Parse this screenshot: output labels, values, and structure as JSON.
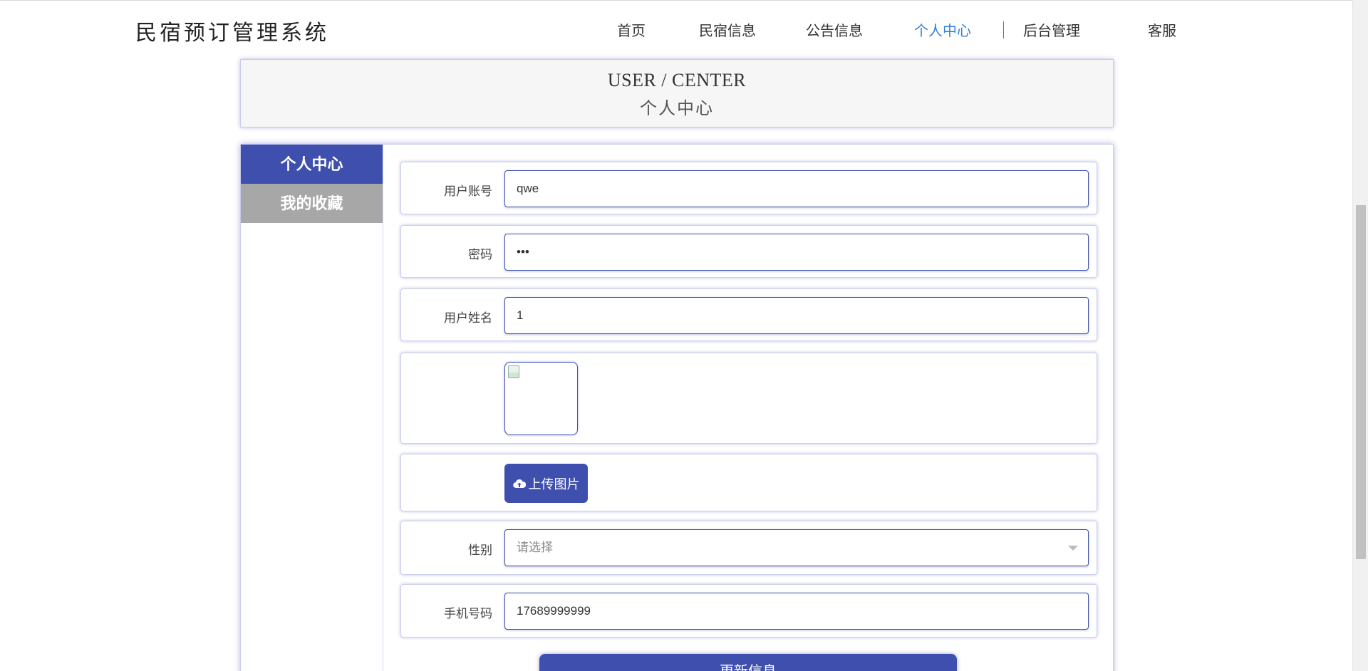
{
  "app": {
    "title": "民宿预订管理系统"
  },
  "nav": {
    "items": [
      {
        "label": "首页"
      },
      {
        "label": "民宿信息"
      },
      {
        "label": "公告信息"
      },
      {
        "label": "个人中心",
        "active": true
      },
      {
        "label": "后台管理"
      },
      {
        "label": "客服"
      }
    ]
  },
  "banner": {
    "title_en": "USER / CENTER",
    "title_cn": "个人中心"
  },
  "sidebar": {
    "items": [
      {
        "label": "个人中心",
        "active": true
      },
      {
        "label": "我的收藏",
        "active": false
      }
    ]
  },
  "form": {
    "account": {
      "label": "用户账号",
      "value": "qwe"
    },
    "password": {
      "label": "密码",
      "value": "•••"
    },
    "name": {
      "label": "用户姓名",
      "value": "1"
    },
    "upload": {
      "label": "上传图片",
      "icon": "cloud-upload-icon"
    },
    "gender": {
      "label": "性别",
      "placeholder": "请选择"
    },
    "phone": {
      "label": "手机号码",
      "value": "17689999999"
    },
    "submit_label": "更新信息"
  },
  "colors": {
    "primary": "#3f4fad",
    "nav_active": "#2f7fe0",
    "sidebar_inactive": "#a7a7a7"
  }
}
